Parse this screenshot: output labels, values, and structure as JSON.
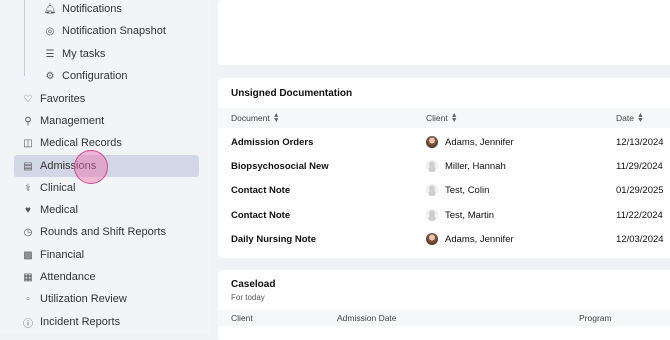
{
  "sidebar": {
    "sub_items": [
      {
        "label": "Notifications",
        "icon": "bell-icon"
      },
      {
        "label": "Notification Snapshot",
        "icon": "target-icon"
      },
      {
        "label": "My tasks",
        "icon": "list-icon"
      },
      {
        "label": "Configuration",
        "icon": "gear-icon"
      }
    ],
    "items": [
      {
        "label": "Favorites",
        "icon": "heart-icon"
      },
      {
        "label": "Management",
        "icon": "pin-icon"
      },
      {
        "label": "Medical Records",
        "icon": "folder-icon"
      },
      {
        "label": "Admissions",
        "icon": "admissions-icon",
        "active": true
      },
      {
        "label": "Clinical",
        "icon": "stethoscope-icon"
      },
      {
        "label": "Medical",
        "icon": "heart-pulse-icon"
      },
      {
        "label": "Rounds and Shift Reports",
        "icon": "clock-icon"
      },
      {
        "label": "Financial",
        "icon": "wallet-icon"
      },
      {
        "label": "Attendance",
        "icon": "calendar-icon"
      },
      {
        "label": "Utilization Review",
        "icon": "clipboard-icon"
      },
      {
        "label": "Incident Reports",
        "icon": "alert-icon"
      }
    ]
  },
  "unsigned": {
    "title": "Unsigned Documentation",
    "columns": {
      "document": "Document",
      "client": "Client",
      "date": "Date"
    },
    "rows": [
      {
        "document": "Admission Orders",
        "client": "Adams, Jennifer",
        "date": "12/13/2024",
        "avatar": "photo"
      },
      {
        "document": "Biopsychosocial New",
        "client": "Miller, Hannah",
        "date": "11/29/2024",
        "avatar": "blank"
      },
      {
        "document": "Contact Note",
        "client": "Test, Colin",
        "date": "01/29/2025",
        "avatar": "blank"
      },
      {
        "document": "Contact Note",
        "client": "Test, Martin",
        "date": "11/22/2024",
        "avatar": "blank"
      },
      {
        "document": "Daily Nursing Note",
        "client": "Adams, Jennifer",
        "date": "12/03/2024",
        "avatar": "photo"
      }
    ]
  },
  "caseload": {
    "title": "Caseload",
    "subtitle": "For today",
    "columns": {
      "client": "Client",
      "admission_date": "Admission Date",
      "program": "Program"
    }
  }
}
